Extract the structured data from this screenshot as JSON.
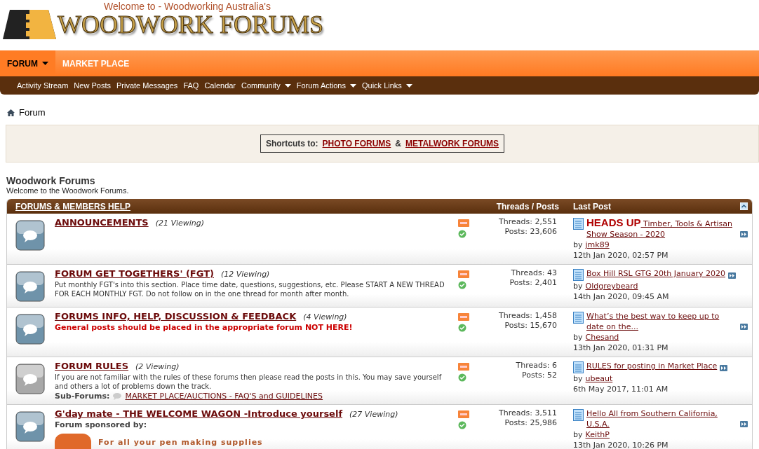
{
  "logo": {
    "tagline": "Welcome to - Woodworking Australia's",
    "title": "WOODWORK FORUMS"
  },
  "main_tabs": [
    {
      "label": "FORUM",
      "selected": true,
      "dropdown": true
    },
    {
      "label": "MARKET PLACE",
      "selected": false,
      "dropdown": false
    }
  ],
  "sub_nav": [
    {
      "label": "Activity Stream",
      "dropdown": false
    },
    {
      "label": "New Posts",
      "dropdown": false
    },
    {
      "label": "Private Messages",
      "dropdown": false
    },
    {
      "label": "FAQ",
      "dropdown": false
    },
    {
      "label": "Calendar",
      "dropdown": false
    },
    {
      "label": "Community",
      "dropdown": true
    },
    {
      "label": "Forum Actions",
      "dropdown": true
    },
    {
      "label": "Quick Links",
      "dropdown": true
    }
  ],
  "breadcrumb": "Forum",
  "shortcuts": {
    "label": "Shortcuts to:",
    "links": [
      "PHOTO FORUMS",
      "METALWORK FORUMS"
    ],
    "separator": "&"
  },
  "section": {
    "title": "Woodwork Forums",
    "subtitle": "Welcome to the Woodwork Forums."
  },
  "table": {
    "category": "FORUMS & MEMBERS HELP",
    "columns": [
      "Threads / Posts",
      "Last Post"
    ],
    "forums": [
      {
        "title": "ANNOUNCEMENTS",
        "viewing": "(21 Viewing)",
        "new_posts": true,
        "threads": "Threads: 2,551",
        "posts": "Posts: 23,606",
        "last_post": {
          "prefix": "HEADS UP",
          "title": "Timber, Tools & Artisan Show Season - 2020",
          "by": "by",
          "user": "jmk89",
          "date": "12th Jan 2020, 02:57 PM"
        }
      },
      {
        "title": "FORUM GET TOGETHERS' (FGT)",
        "viewing": "(12 Viewing)",
        "new_posts": true,
        "description": "Put monthly FGT's into this section. Place time date, questions, suggestions, etc. Please START A NEW THREAD FOR EACH MONTHLY FGT. Do not follow on in the one thread for month after month.",
        "threads": "Threads: 43",
        "posts": "Posts: 2,401",
        "last_post": {
          "title": "Box Hill RSL GTG 20th January 2020",
          "by": "by",
          "user": "Oldgreybeard",
          "date": "14th Jan 2020, 09:45 AM"
        }
      },
      {
        "title": "FORUMS INFO, HELP, DISCUSSION & FEEDBACK",
        "viewing": "(4 Viewing)",
        "new_posts": true,
        "notice": "General posts should be placed in the appropriate forum **NOT HERE!**",
        "threads": "Threads: 1,458",
        "posts": "Posts: 15,670",
        "last_post": {
          "title": "What’s the best way to keep up to date on the...",
          "by": "by",
          "user": "Chesand",
          "date": "13th Jan 2020, 01:31 PM"
        }
      },
      {
        "title": "FORUM RULES",
        "viewing": "(2 Viewing)",
        "new_posts": false,
        "description": "If you are not familiar with the rules of these forums then please read the posts in this. You may save yourself and others a lot of problems down the track.",
        "subforums_label": "Sub-Forums:",
        "subforums": [
          "MARKET PLACE/AUCTIONS - FAQ'S and GUIDELINES"
        ],
        "threads": "Threads: 6",
        "posts": "Posts: 52",
        "last_post": {
          "title": "RULES for posting in Market Place",
          "by": "by",
          "user": "ubeaut",
          "date": "6th May 2017, 11:01 AM"
        }
      },
      {
        "title": "G'day mate - THE WELCOME WAGON -Introduce yourself",
        "viewing": "(27 Viewing)",
        "new_posts": true,
        "sponsor_label": "Forum sponsored by:",
        "sponsor_tagline": "For all your pen making supplies",
        "threads": "Threads: 3,511",
        "posts": "Posts: 25,986",
        "last_post": {
          "title": "Hello All from Southern California, U.S.A.",
          "by": "by",
          "user": "KeithP",
          "date": "13th Jan 2020, 10:26 PM"
        }
      }
    ]
  }
}
